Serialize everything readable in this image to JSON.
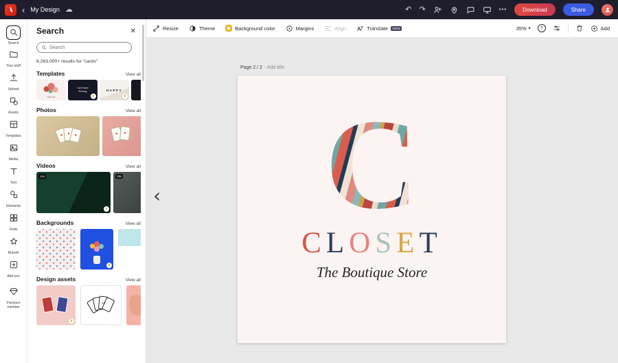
{
  "topbar": {
    "back": "‹",
    "title": "My Design",
    "cloud": "☁",
    "undo": "↶",
    "redo": "↷",
    "more": "•••",
    "download": "Download",
    "share": "Share"
  },
  "rail": {
    "items": [
      {
        "label": "Search"
      },
      {
        "label": "Your stuff"
      },
      {
        "label": "Upload"
      },
      {
        "label": "Assets"
      },
      {
        "label": "Templates"
      },
      {
        "label": "Media"
      },
      {
        "label": "Text"
      },
      {
        "label": "Elements"
      },
      {
        "label": "Grids"
      },
      {
        "label": "Brands"
      },
      {
        "label": "Add-ons"
      },
      {
        "label": "Premium member"
      }
    ]
  },
  "panel": {
    "title": "Search",
    "close": "✕",
    "search_placeholder": "Search",
    "results": "6,263,000+ results for \"cards\"",
    "sections": {
      "templates": {
        "title": "Templates",
        "view_all": "View all"
      },
      "photos": {
        "title": "Photos",
        "view_all": "View all"
      },
      "videos": {
        "title": "Videos",
        "view_all": "View all"
      },
      "backgrounds": {
        "title": "Backgrounds",
        "view_all": "View all"
      },
      "design_assets": {
        "title": "Design assets",
        "view_all": "View all"
      }
    },
    "template_labels": {
      "t1": "Thank You",
      "t2": "Card Game Evening",
      "t3": "HAPPY"
    },
    "video_durations": {
      "v1": "14s",
      "v2": "19s"
    },
    "asset_card_label": "21",
    "crown": "♛",
    "heart": "♥"
  },
  "toolbar": {
    "resize": "Resize",
    "theme": "Theme",
    "background_color": "Background color",
    "margins": "Margins",
    "align": "Align",
    "translate": "Translate",
    "new_badge": "NEW",
    "zoom": "35%",
    "zoom_caret": "▾",
    "help": "?",
    "add": "Add"
  },
  "canvas": {
    "page_label": "Page 2 / 2",
    "page_hint": "- Add title",
    "nav_prev": "‹",
    "big_letter": "C",
    "brand": [
      {
        "ch": "C",
        "color": "#d94f43"
      },
      {
        "ch": "L",
        "color": "#2e3d5c"
      },
      {
        "ch": "O",
        "color": "#e8837e"
      },
      {
        "ch": "S",
        "color": "#a9c3bd"
      },
      {
        "ch": "E",
        "color": "#d7a83f"
      },
      {
        "ch": "T",
        "color": "#2e3d5c"
      }
    ],
    "subtitle": "The Boutique Store"
  },
  "colors": {
    "download_red": "#d63f45",
    "share_blue": "#3b5be0",
    "background_color_icon_yellow": "#f0b429",
    "canvas_pink": "#fcf4f2",
    "topbar_dark": "#1e1e2c"
  }
}
